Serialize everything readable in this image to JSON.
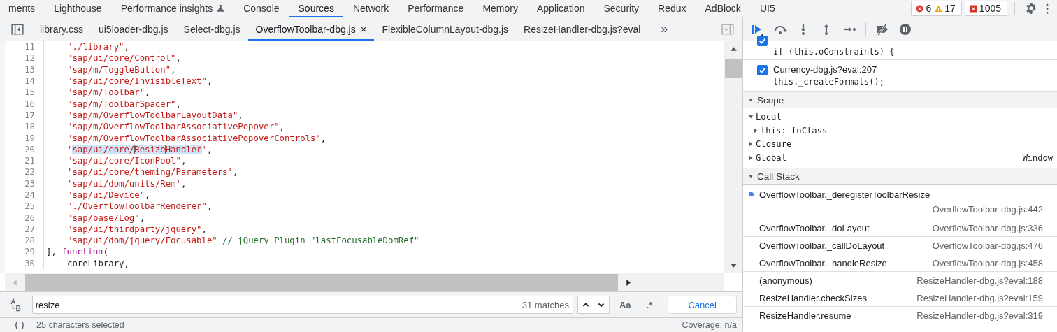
{
  "main_tabs": [
    {
      "label": "ments",
      "selected": false
    },
    {
      "label": "Lighthouse",
      "selected": false
    },
    {
      "label": "Performance insights",
      "selected": false,
      "experimental": true
    },
    {
      "label": "Console",
      "selected": false
    },
    {
      "label": "Sources",
      "selected": true
    },
    {
      "label": "Network",
      "selected": false
    },
    {
      "label": "Performance",
      "selected": false
    },
    {
      "label": "Memory",
      "selected": false
    },
    {
      "label": "Application",
      "selected": false
    },
    {
      "label": "Security",
      "selected": false
    },
    {
      "label": "Redux",
      "selected": false
    },
    {
      "label": "AdBlock",
      "selected": false
    },
    {
      "label": "UI5",
      "selected": false
    }
  ],
  "counters": {
    "errors": "6",
    "warnings": "17",
    "issues": "1005"
  },
  "file_tabs": [
    {
      "label": "library.css",
      "selected": false
    },
    {
      "label": "ui5loader-dbg.js",
      "selected": false
    },
    {
      "label": "Select-dbg.js",
      "selected": false
    },
    {
      "label": "OverflowToolbar-dbg.js",
      "selected": true,
      "close": "×"
    },
    {
      "label": "FlexibleColumnLayout-dbg.js",
      "selected": false
    },
    {
      "label": "ResizeHandler-dbg.js?eval",
      "selected": false
    }
  ],
  "more_tabs": "»",
  "code_lines": [
    {
      "number": "11",
      "indented": true,
      "tokens": [
        {
          "text": "\"./library\"",
          "kind": "string"
        },
        {
          "text": ",",
          "kind": "plain"
        }
      ]
    },
    {
      "number": "12",
      "indented": true,
      "tokens": [
        {
          "text": "\"sap/ui/core/Control\"",
          "kind": "string"
        },
        {
          "text": ",",
          "kind": "plain"
        }
      ]
    },
    {
      "number": "13",
      "indented": true,
      "tokens": [
        {
          "text": "\"sap/m/ToggleButton\"",
          "kind": "string"
        },
        {
          "text": ",",
          "kind": "plain"
        }
      ]
    },
    {
      "number": "14",
      "indented": true,
      "tokens": [
        {
          "text": "\"sap/ui/core/InvisibleText\"",
          "kind": "string"
        },
        {
          "text": ",",
          "kind": "plain"
        }
      ]
    },
    {
      "number": "15",
      "indented": true,
      "tokens": [
        {
          "text": "\"sap/m/Toolbar\"",
          "kind": "string"
        },
        {
          "text": ",",
          "kind": "plain"
        }
      ]
    },
    {
      "number": "16",
      "indented": true,
      "tokens": [
        {
          "text": "\"sap/m/ToolbarSpacer\"",
          "kind": "string"
        },
        {
          "text": ",",
          "kind": "plain"
        }
      ]
    },
    {
      "number": "17",
      "indented": true,
      "tokens": [
        {
          "text": "\"sap/m/OverflowToolbarLayoutData\"",
          "kind": "string"
        },
        {
          "text": ",",
          "kind": "plain"
        }
      ]
    },
    {
      "number": "18",
      "indented": true,
      "tokens": [
        {
          "text": "\"sap/m/OverflowToolbarAssociativePopover\"",
          "kind": "string"
        },
        {
          "text": ",",
          "kind": "plain"
        }
      ]
    },
    {
      "number": "19",
      "indented": true,
      "tokens": [
        {
          "text": "\"sap/m/OverflowToolbarAssociativePopoverControls\"",
          "kind": "string"
        },
        {
          "text": ",",
          "kind": "plain"
        }
      ]
    },
    {
      "number": "20",
      "indented": true,
      "tokens": [
        {
          "text": "'",
          "kind": "string"
        },
        {
          "text": "sap/ui/core/",
          "kind": "selected"
        },
        {
          "text": "Resize",
          "kind": "match"
        },
        {
          "text": "Handler",
          "kind": "selected"
        },
        {
          "text": "'",
          "kind": "string"
        },
        {
          "text": ",",
          "kind": "plain"
        }
      ]
    },
    {
      "number": "21",
      "indented": true,
      "tokens": [
        {
          "text": "\"sap/ui/core/IconPool\"",
          "kind": "string"
        },
        {
          "text": ",",
          "kind": "plain"
        }
      ]
    },
    {
      "number": "22",
      "indented": true,
      "tokens": [
        {
          "text": "'sap/ui/core/theming/Parameters'",
          "kind": "string"
        },
        {
          "text": ",",
          "kind": "plain"
        }
      ]
    },
    {
      "number": "23",
      "indented": true,
      "tokens": [
        {
          "text": "'sap/ui/dom/units/Rem'",
          "kind": "string"
        },
        {
          "text": ",",
          "kind": "plain"
        }
      ]
    },
    {
      "number": "24",
      "indented": true,
      "tokens": [
        {
          "text": "\"sap/ui/Device\"",
          "kind": "string"
        },
        {
          "text": ",",
          "kind": "plain"
        }
      ]
    },
    {
      "number": "25",
      "indented": true,
      "tokens": [
        {
          "text": "\"./OverflowToolbarRenderer\"",
          "kind": "string"
        },
        {
          "text": ",",
          "kind": "plain"
        }
      ]
    },
    {
      "number": "26",
      "indented": true,
      "tokens": [
        {
          "text": "\"sap/base/Log\"",
          "kind": "string"
        },
        {
          "text": ",",
          "kind": "plain"
        }
      ]
    },
    {
      "number": "27",
      "indented": true,
      "tokens": [
        {
          "text": "\"sap/ui/thirdparty/jquery\"",
          "kind": "string"
        },
        {
          "text": ",",
          "kind": "plain"
        }
      ]
    },
    {
      "number": "28",
      "indented": true,
      "tokens": [
        {
          "text": "\"sap/ui/dom/jquery/Focusable\"",
          "kind": "string"
        },
        {
          "text": "// jQuery Plugin \"lastFocusableDomRef\"",
          "kind": "comment"
        }
      ]
    },
    {
      "number": "29",
      "indented": false,
      "tokens": [
        {
          "text": "],",
          "kind": "plain"
        },
        {
          "text": "function",
          "kind": "keyword"
        },
        {
          "text": "(",
          "kind": "plain"
        }
      ]
    },
    {
      "number": "30",
      "indented": true,
      "tokens": [
        {
          "text": "coreLibrary,",
          "kind": "plain"
        }
      ]
    }
  ],
  "search": {
    "value": "resize",
    "matches": "31 matches",
    "case_label": "Aa",
    "regex_label": ".*",
    "cancel": "Cancel"
  },
  "status_bar": {
    "selection": "25 characters selected",
    "coverage": "Coverage: n/a"
  },
  "breakpoints": [
    {
      "code": "if (this.oConstraints) {",
      "checked": true
    },
    {
      "file": "Currency-dbg.js?eval:207",
      "code": "this._createFormats();",
      "checked": true
    }
  ],
  "scope": {
    "title": "Scope",
    "expanded": true,
    "items": [
      {
        "label": "Local",
        "expanded": true,
        "children": [
          {
            "label": "this: fnClass",
            "expanded": false
          }
        ]
      },
      {
        "label": "Closure",
        "expanded": false
      },
      {
        "label": "Global",
        "expanded": false,
        "value": "Window"
      }
    ]
  },
  "call_stack": {
    "title": "Call Stack",
    "expanded": true,
    "frames": [
      {
        "name": "OverflowToolbar._deregisterToolbarResize",
        "location": "OverflowToolbar-dbg.js:442",
        "selected": true
      },
      {
        "name": "OverflowToolbar._doLayout",
        "location": "OverflowToolbar-dbg.js:336",
        "selected": false
      },
      {
        "name": "OverflowToolbar._callDoLayout",
        "location": "OverflowToolbar-dbg.js:476",
        "selected": false
      },
      {
        "name": "OverflowToolbar._handleResize",
        "location": "OverflowToolbar-dbg.js:458",
        "selected": false
      },
      {
        "name": "(anonymous)",
        "location": "ResizeHandler-dbg.js?eval:188",
        "selected": false
      },
      {
        "name": "ResizeHandler.checkSizes",
        "location": "ResizeHandler-dbg.js?eval:159",
        "selected": false
      },
      {
        "name": "ResizeHandler.resume",
        "location": "ResizeHandler-dbg.js?eval:319",
        "selected": false
      }
    ]
  }
}
